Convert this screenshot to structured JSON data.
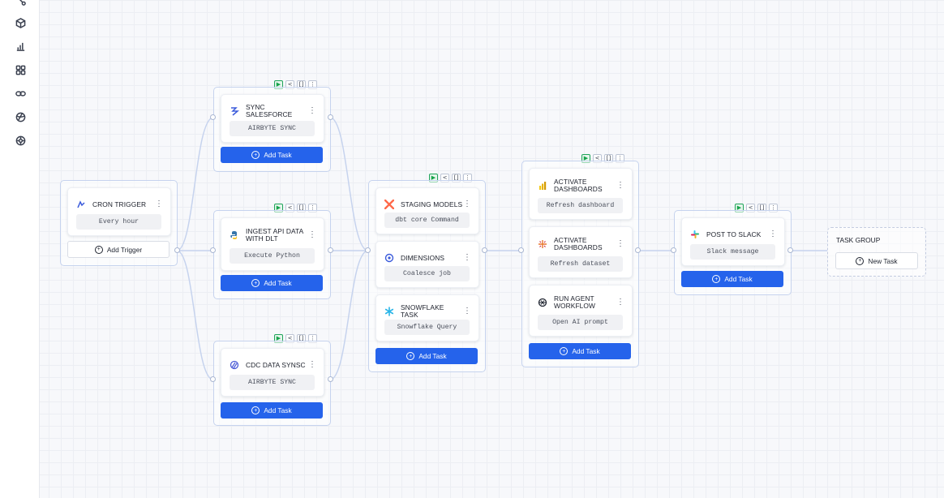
{
  "sidebar": {
    "items": [
      {
        "icon": "flow-icon"
      },
      {
        "icon": "cube-icon"
      },
      {
        "icon": "bar-chart-icon"
      },
      {
        "icon": "grid-icon"
      },
      {
        "icon": "link-icon"
      },
      {
        "icon": "globe-icon"
      },
      {
        "icon": "network-icon"
      }
    ]
  },
  "toolbar": {
    "run": "▶",
    "share": "<",
    "vars": "[]",
    "more": "⋮"
  },
  "trigger": {
    "title": "CRON TRIGGER",
    "schedule": "Every hour",
    "add_label": "Add Trigger"
  },
  "stage1": [
    {
      "title": "SYNC SALESFORCE",
      "command": "AIRBYTE SYNC",
      "add_label": "Add Task",
      "icon": "airbyte-icon"
    },
    {
      "title": "INGEST API DATA WITH DLT",
      "command": "Execute Python",
      "add_label": "Add Task",
      "icon": "python-icon"
    },
    {
      "title": "CDC DATA SYNSC",
      "command": "AIRBYTE SYNC",
      "add_label": "Add Task",
      "icon": "airbyte-icon"
    }
  ],
  "stage2": {
    "tasks": [
      {
        "title": "STAGING MODELS",
        "command": "dbt core Command",
        "icon": "dbt-icon"
      },
      {
        "title": "DIMENSIONS",
        "command": "Coalesce job",
        "icon": "coalesce-icon"
      },
      {
        "title": "SNOWFLAKE TASK",
        "command": "Snowflake Query",
        "icon": "snowflake-icon"
      }
    ],
    "add_label": "Add Task"
  },
  "stage3": {
    "tasks": [
      {
        "title": "ACTIVATE DASHBOARDS",
        "command": "Refresh dashboard",
        "icon": "power-bi-icon"
      },
      {
        "title": "ACTIVATE DASHBOARDS",
        "command": "Refresh dataset",
        "icon": "tableau-icon"
      },
      {
        "title": "RUN AGENT WORKFLOW",
        "command": "Open AI prompt",
        "icon": "openai-icon"
      }
    ],
    "add_label": "Add Task"
  },
  "stage4": {
    "title": "POST TO SLACK",
    "command": "Slack message",
    "add_label": "Add Task",
    "icon": "slack-icon"
  },
  "task_group": {
    "title": "TASK GROUP",
    "new_label": "New Task"
  },
  "colors": {
    "accent": "#2563eb",
    "run": "#16a34a",
    "wire": "#c6d3ee"
  }
}
